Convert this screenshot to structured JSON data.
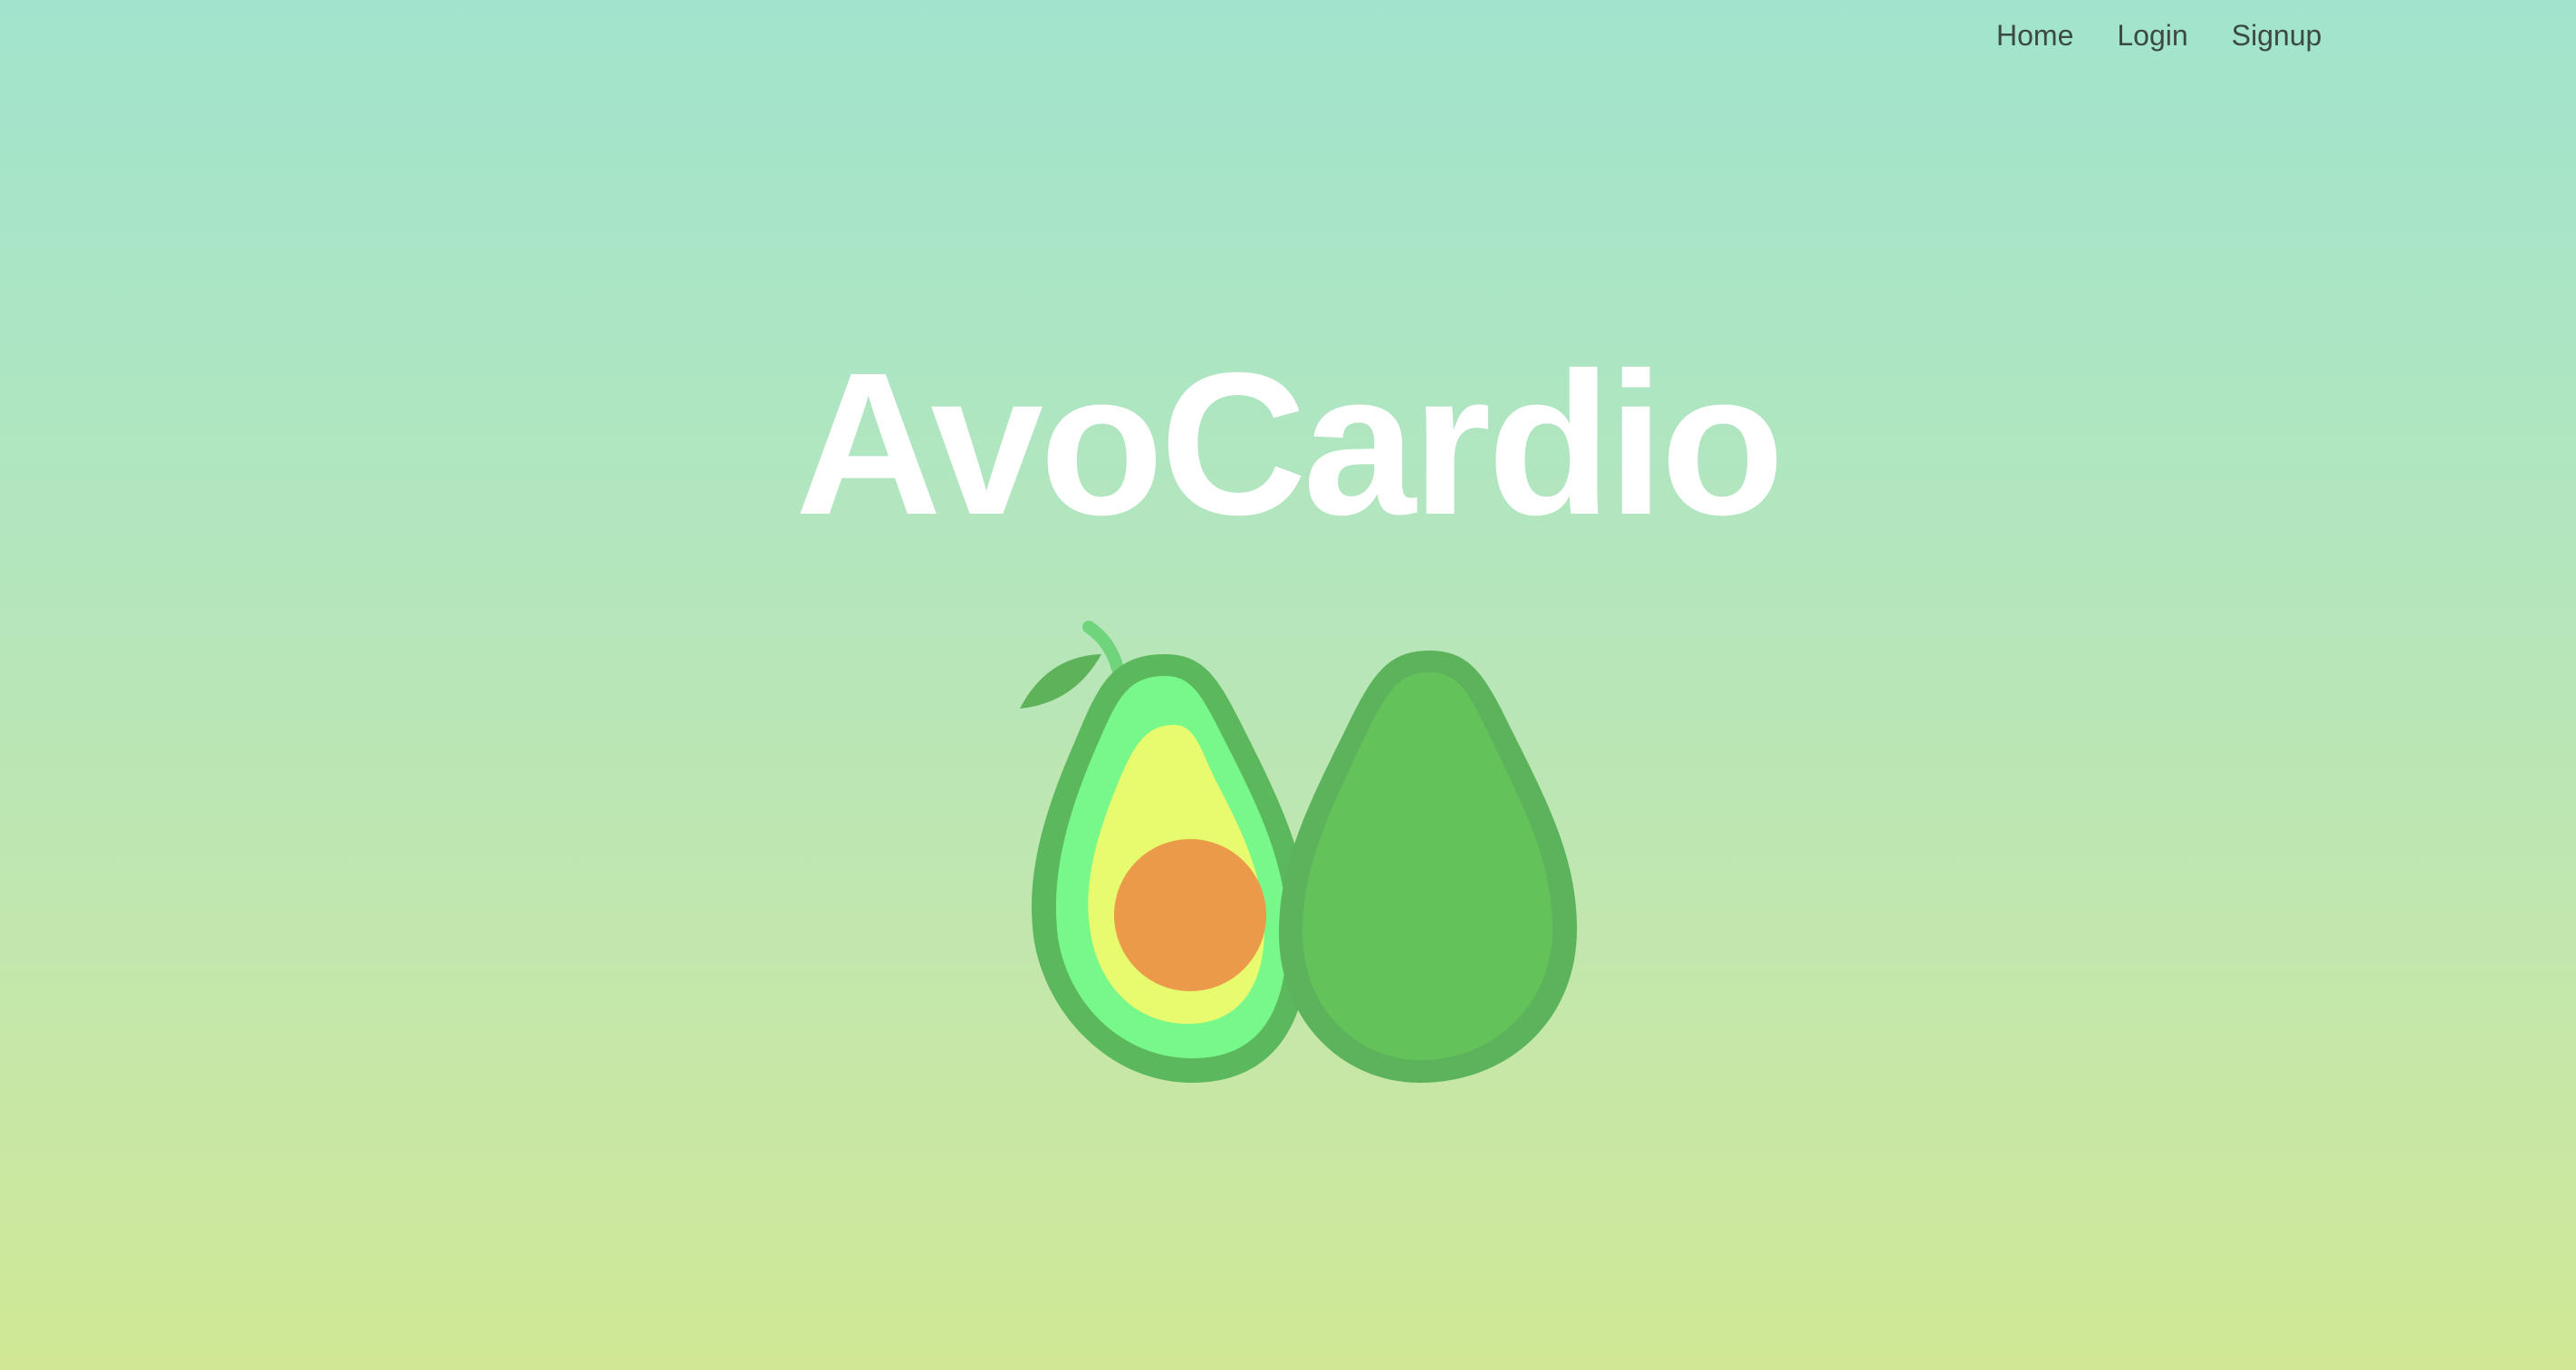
{
  "nav": {
    "links": [
      "Home",
      "Login",
      "Signup"
    ]
  },
  "hero": {
    "title": "AvoCardio",
    "logo_icon": "avocado-icon"
  },
  "colors": {
    "background_top": "#a1e4cd",
    "background_bottom": "#d0e895",
    "title": "#ffffff",
    "nav_text": "#3c4a44",
    "avocado_skin": "#5cb85c",
    "avocado_flesh_outer": "#78f78a",
    "avocado_flesh_inner": "#e8fb6e",
    "avocado_pit": "#ea9a48",
    "avocado_whole": "#63c35a"
  }
}
